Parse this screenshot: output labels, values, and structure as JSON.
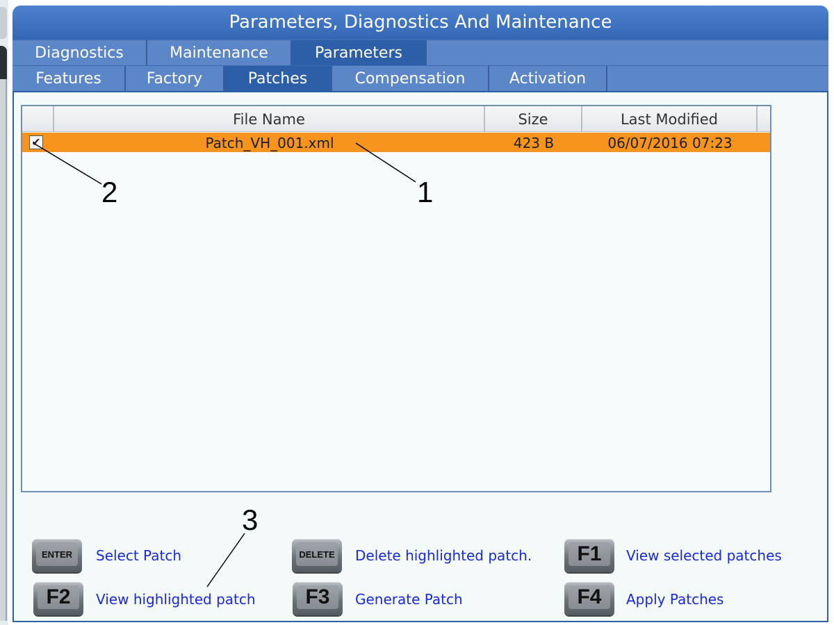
{
  "window": {
    "title": "Parameters, Diagnostics And Maintenance"
  },
  "tabs_row1": [
    {
      "label": "Diagnostics",
      "active": false
    },
    {
      "label": "Maintenance",
      "active": false
    },
    {
      "label": "Parameters",
      "active": true
    }
  ],
  "tabs_row2": [
    {
      "label": "Features",
      "active": false
    },
    {
      "label": "Factory",
      "active": false
    },
    {
      "label": "Patches",
      "active": true
    },
    {
      "label": "Compensation",
      "active": false
    },
    {
      "label": "Activation",
      "active": false
    }
  ],
  "table": {
    "headers": {
      "file_name": "File Name",
      "size": "Size",
      "last_modified": "Last Modified"
    },
    "rows": [
      {
        "checked": true,
        "check_mark": "✔",
        "file_name": "Patch_VH_001.xml",
        "size": "423 B",
        "last_modified": "06/07/2016 07:23"
      }
    ]
  },
  "callouts": [
    "1",
    "2",
    "3"
  ],
  "keys": [
    {
      "key": "ENTER",
      "label": "Select Patch"
    },
    {
      "key": "DELETE",
      "label": "Delete highlighted patch."
    },
    {
      "key": "F1",
      "label": "View selected patches"
    },
    {
      "key": "F2",
      "label": "View highlighted patch"
    },
    {
      "key": "F3",
      "label": "Generate Patch"
    },
    {
      "key": "F4",
      "label": "Apply Patches"
    }
  ],
  "colors": {
    "title_bar": "#3b6db5",
    "active_tab": "#2d5ea8",
    "tab": "#5b86c8",
    "highlight_row": "#f7941d",
    "key_label": "#1a2ad8"
  }
}
